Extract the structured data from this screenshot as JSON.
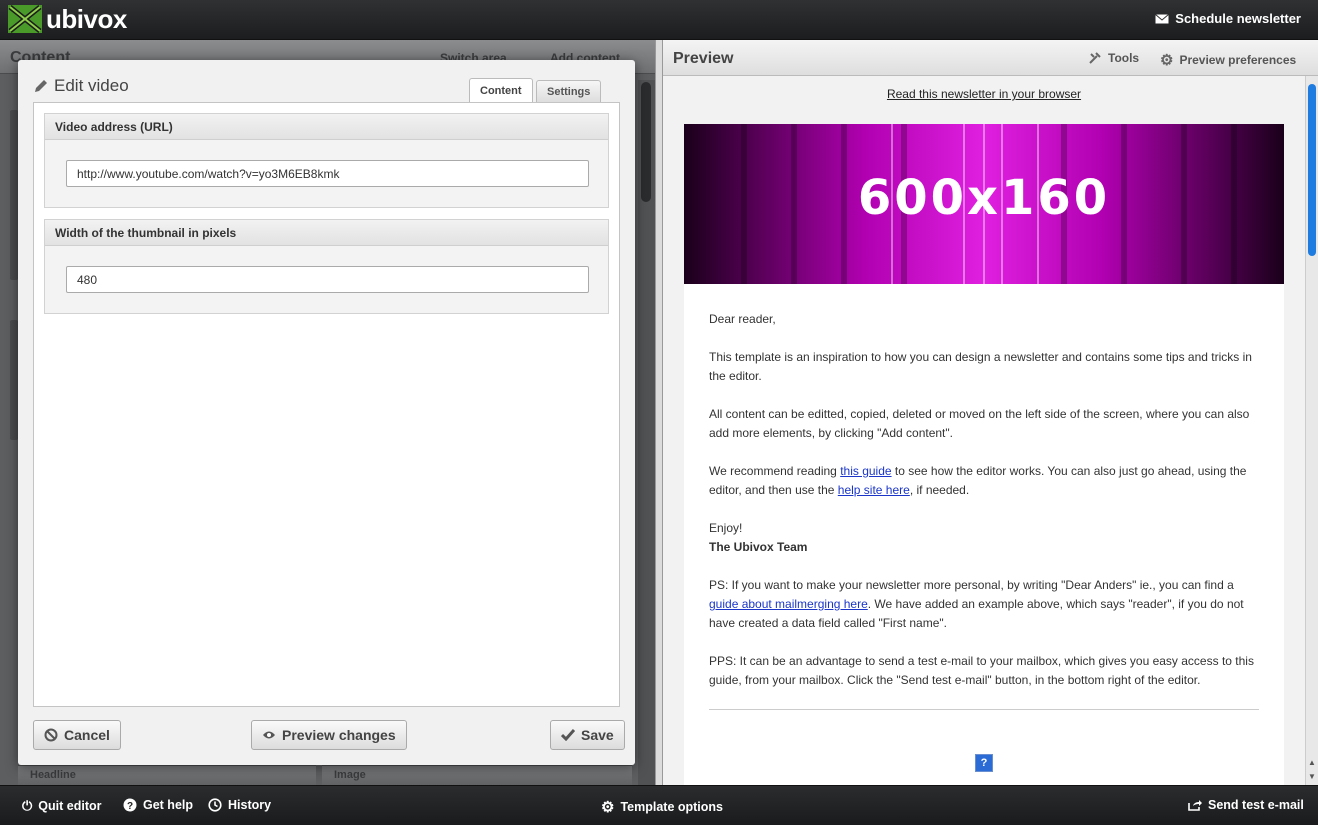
{
  "app": {
    "name": "ubivox"
  },
  "topbar": {
    "schedule_label": "Schedule newsletter"
  },
  "left_panel": {
    "title": "Content",
    "switch_area": "Switch area",
    "add_content": "Add content",
    "bottom_items": [
      "Headline",
      "Image"
    ]
  },
  "modal": {
    "title": "Edit video",
    "tabs": [
      {
        "label": "Content",
        "active": true
      },
      {
        "label": "Settings",
        "active": false
      }
    ],
    "fields": [
      {
        "label": "Video address (URL)",
        "value": "http://www.youtube.com/watch?v=yo3M6EB8kmk"
      },
      {
        "label": "Width of the thumbnail in pixels",
        "value": "480"
      }
    ],
    "buttons": {
      "cancel": "Cancel",
      "preview": "Preview changes",
      "save": "Save"
    }
  },
  "preview": {
    "title": "Preview",
    "tools": "Tools",
    "preferences": "Preview preferences",
    "read_in_browser": "Read this newsletter in your browser",
    "banner_text": "600x160",
    "body": {
      "greeting": "Dear reader,",
      "p1": "This template is an inspiration to how you can design a newsletter and contains some tips and tricks in the editor.",
      "p2": "All content can be editted, copied, deleted or moved on the left side of the screen, where you can also add more elements, by clicking \"Add content\".",
      "p3_a": "We recommend reading ",
      "p3_link1": "this guide",
      "p3_b": " to see how the editor works. You can also just go ahead, using the editor, and then use the ",
      "p3_link2": "help site here",
      "p3_c": ", if needed.",
      "enjoy": "Enjoy!",
      "team": "The Ubivox Team",
      "ps_a": "PS: If you want to make your newsletter more personal, by writing \"Dear Anders\" ie., you can find a ",
      "ps_link": "guide about mailmerging here",
      "ps_b": ". We have added an example above, which says \"reader\", if you do not have created a data field called \"First name\".",
      "pps": "PPS: It can be an advantage to send a test e-mail to your mailbox, which gives you easy access to this guide, from your mailbox. Click the \"Send test e-mail\" button, in the bottom right of the editor.",
      "video_placeholder": "?"
    }
  },
  "bottombar": {
    "quit": "Quit editor",
    "help": "Get help",
    "history": "History",
    "template": "Template options",
    "send_test": "Send test e-mail"
  },
  "colors": {
    "accent_link": "#1a35c8",
    "banner": "#d400d4",
    "scroll_thumb": "#1e7be0"
  }
}
